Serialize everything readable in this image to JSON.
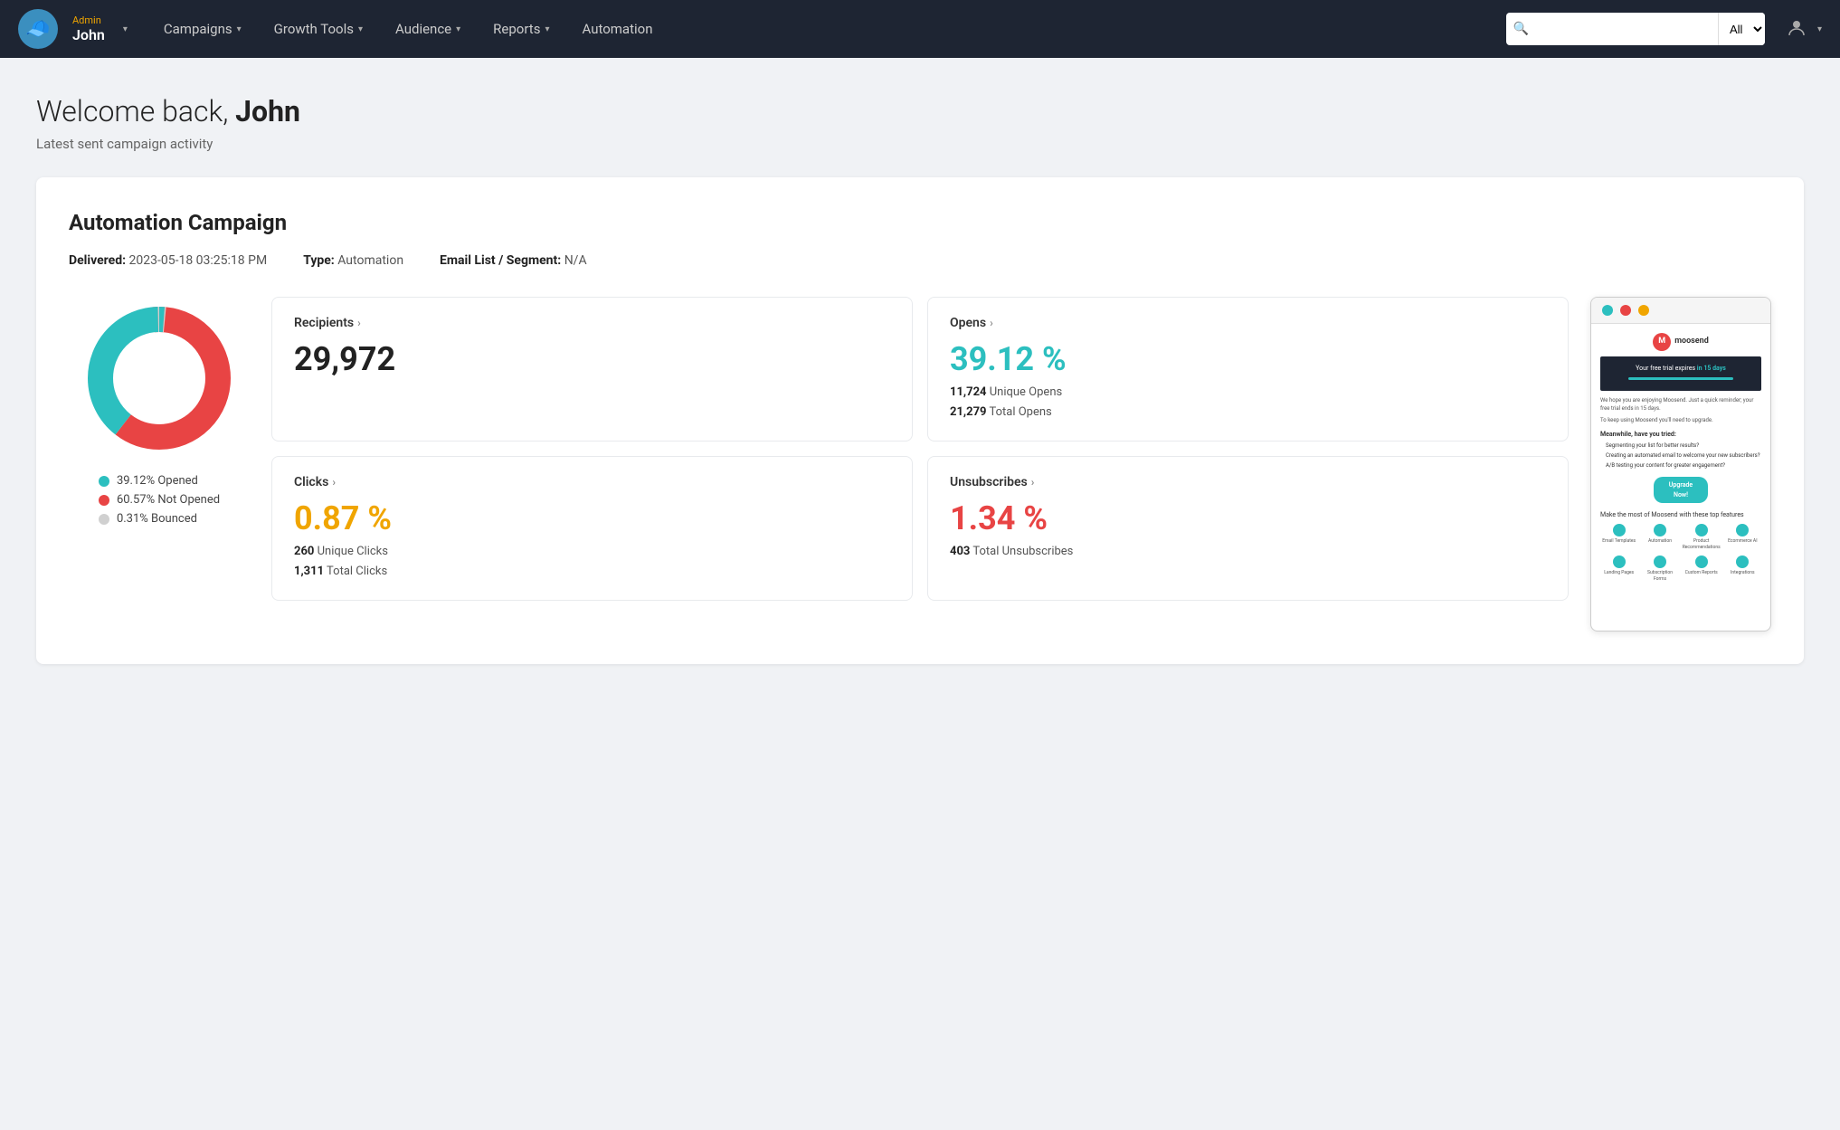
{
  "navbar": {
    "user_role": "Admin",
    "user_name": "John",
    "logo_emoji": "🧢",
    "menu_items": [
      {
        "label": "Campaigns",
        "has_arrow": true
      },
      {
        "label": "Growth Tools",
        "has_arrow": true
      },
      {
        "label": "Audience",
        "has_arrow": true
      },
      {
        "label": "Reports",
        "has_arrow": true
      },
      {
        "label": "Automation",
        "has_arrow": false
      }
    ],
    "search_placeholder": "",
    "search_default_option": "All"
  },
  "page": {
    "welcome_prefix": "Welcome back, ",
    "welcome_name": "John",
    "subtitle": "Latest sent campaign activity"
  },
  "campaign": {
    "title": "Automation Campaign",
    "delivered_label": "Delivered:",
    "delivered_value": "2023-05-18 03:25:18 PM",
    "type_label": "Type:",
    "type_value": "Automation",
    "email_list_label": "Email List / Segment:",
    "email_list_value": "N/A"
  },
  "stats": {
    "recipients": {
      "label": "Recipients",
      "value": "29,972"
    },
    "opens": {
      "label": "Opens",
      "percentage": "39.12 %",
      "unique": "11,724",
      "unique_label": "Unique Opens",
      "total": "21,279",
      "total_label": "Total Opens"
    },
    "clicks": {
      "label": "Clicks",
      "percentage": "0.87 %",
      "unique": "260",
      "unique_label": "Unique Clicks",
      "total": "1,311",
      "total_label": "Total Clicks"
    },
    "unsubscribes": {
      "label": "Unsubscribes",
      "percentage": "1.34 %",
      "total": "403",
      "total_label": "Total Unsubscribes"
    }
  },
  "donut": {
    "opened_pct": 39.12,
    "not_opened_pct": 60.57,
    "bounced_pct": 0.31,
    "legend": [
      {
        "label": "39.12% Opened",
        "color": "#2cbfbf"
      },
      {
        "label": "60.57% Not Opened",
        "color": "#e84444"
      },
      {
        "label": "0.31% Bounced",
        "color": "#d0d0d0"
      }
    ]
  },
  "email_preview": {
    "title_dots": [
      "teal",
      "red",
      "gold"
    ],
    "logo_text": "moosend",
    "banner_text_pre": "Your free trial expires ",
    "banner_highlight": "in 15 days",
    "body_text_1": "We hope you are enjoying Moosend. Just a quick reminder; your free trial ends in 15 days.",
    "body_text_2": "To keep using Moosend you'll need to upgrade.",
    "meanwhile_title": "Meanwhile, have you tried:",
    "list_items": [
      "Segmenting your list for better results?",
      "Creating an automated email to welcome your new subscribers?",
      "A/B testing your content for greater engagement?"
    ],
    "upgrade_btn": "Upgrade Now!",
    "features_title": "Make the most of Moosend with these top features",
    "feature_icons": [
      "Email Templates",
      "Automation",
      "Product Recommendations",
      "Ecommerce AI",
      "Landing Pages",
      "Subscription Forms",
      "Custom Reports",
      "Integrations"
    ]
  }
}
